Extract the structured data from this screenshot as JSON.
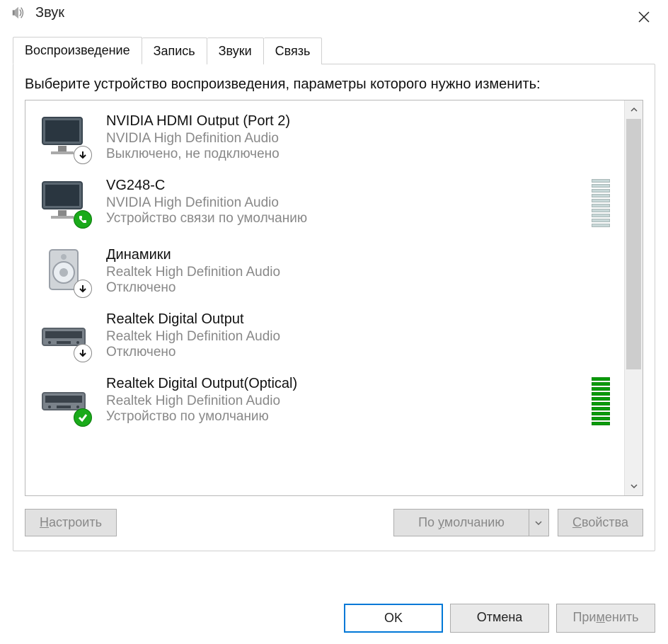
{
  "window": {
    "title": "Звук"
  },
  "tabs": [
    {
      "label": "Воспроизведение",
      "active": true
    },
    {
      "label": "Запись",
      "active": false
    },
    {
      "label": "Звуки",
      "active": false
    },
    {
      "label": "Связь",
      "active": false
    }
  ],
  "instruction": "Выберите устройство воспроизведения, параметры которого нужно изменить:",
  "devices": [
    {
      "name": "NVIDIA HDMI Output (Port 2)",
      "driver": "NVIDIA High Definition Audio",
      "status": "Выключено, не подключено",
      "icon": "monitor",
      "badge": "down",
      "meter": null
    },
    {
      "name": "VG248-C",
      "driver": "NVIDIA High Definition Audio",
      "status": "Устройство связи по умолчанию",
      "icon": "monitor",
      "badge": "phone",
      "meter": {
        "bars": 10,
        "active": 0
      }
    },
    {
      "name": "Динамики",
      "driver": "Realtek High Definition Audio",
      "status": "Отключено",
      "icon": "speaker",
      "badge": "down",
      "meter": null
    },
    {
      "name": "Realtek Digital Output",
      "driver": "Realtek High Definition Audio",
      "status": "Отключено",
      "icon": "receiver",
      "badge": "down",
      "meter": null
    },
    {
      "name": "Realtek Digital Output(Optical)",
      "driver": "Realtek High Definition Audio",
      "status": "Устройство по умолчанию",
      "icon": "receiver",
      "badge": "check",
      "meter": {
        "bars": 10,
        "active": 10
      }
    }
  ],
  "panel_buttons": {
    "configure": "Настроить",
    "set_default": "По умолчанию",
    "properties": "Свойства"
  },
  "dialog_buttons": {
    "ok": "OK",
    "cancel": "Отмена",
    "apply": "Применить"
  }
}
